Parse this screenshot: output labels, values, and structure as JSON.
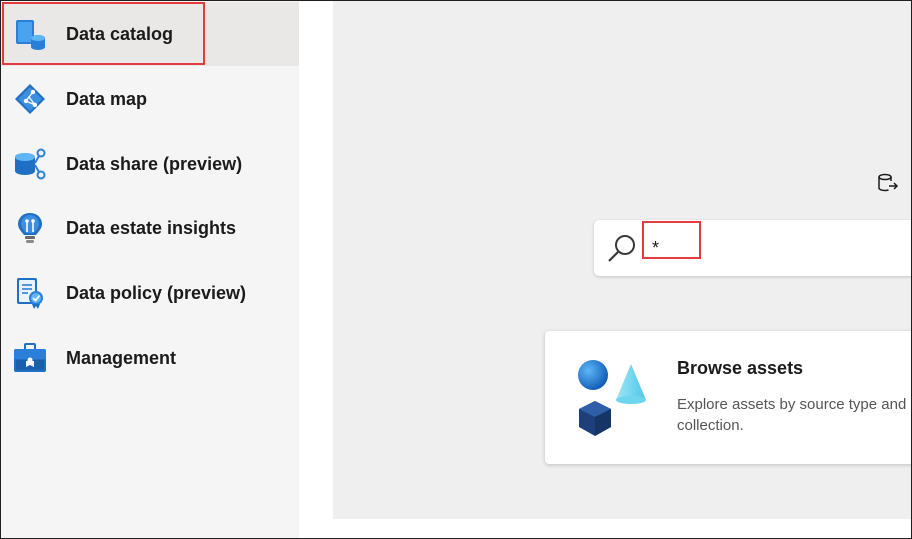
{
  "sidebar": {
    "items": [
      {
        "label": "Data catalog",
        "icon": "data-catalog-icon",
        "active": true
      },
      {
        "label": "Data map",
        "icon": "data-map-icon"
      },
      {
        "label": "Data share (preview)",
        "icon": "data-share-icon"
      },
      {
        "label": "Data estate insights",
        "icon": "data-estate-insights-icon"
      },
      {
        "label": "Data policy (preview)",
        "icon": "data-policy-icon"
      },
      {
        "label": "Management",
        "icon": "management-icon"
      }
    ]
  },
  "search": {
    "value": "*",
    "icon": "search-icon"
  },
  "browse_card": {
    "title": "Browse assets",
    "description": "Explore assets by source type and collection.",
    "icon": "browse-assets-illustration"
  },
  "colors": {
    "highlight": "#e43c3c",
    "accent": "#0078d4"
  }
}
